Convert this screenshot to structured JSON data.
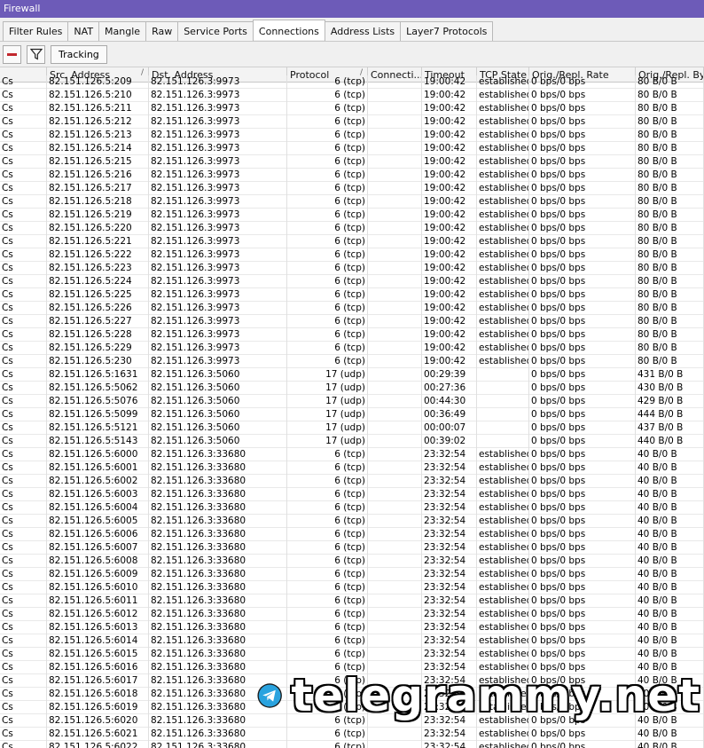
{
  "window": {
    "title": "Firewall"
  },
  "tabs": [
    {
      "label": "Filter Rules",
      "width": 66
    },
    {
      "label": "NAT",
      "width": 36
    },
    {
      "label": "Mangle",
      "width": 50
    },
    {
      "label": "Raw",
      "width": 36
    },
    {
      "label": "Service Ports",
      "width": 76
    },
    {
      "label": "Connections",
      "width": 74,
      "active": true
    },
    {
      "label": "Address Lists",
      "width": 76
    },
    {
      "label": "Layer7 Protocols",
      "width": 92
    }
  ],
  "toolbar": {
    "remove_icon": "minus-icon",
    "filter_icon": "filter-icon",
    "tracking_label": "Tracking"
  },
  "columns": [
    "",
    "Src. Address",
    "Dst. Address",
    "Protocol",
    "Connecti...",
    "Timeout",
    "TCP State",
    "Orig./Repl. Rate",
    "Orig./Repl. Bytes"
  ],
  "rows": [
    [
      "Cs",
      "82.151.126.5:209",
      "82.151.126.3:9973",
      "6 (tcp)",
      "",
      "19:00:42",
      "established",
      "0 bps/0 bps",
      "80 B/0 B"
    ],
    [
      "Cs",
      "82.151.126.5:210",
      "82.151.126.3:9973",
      "6 (tcp)",
      "",
      "19:00:42",
      "established",
      "0 bps/0 bps",
      "80 B/0 B"
    ],
    [
      "Cs",
      "82.151.126.5:211",
      "82.151.126.3:9973",
      "6 (tcp)",
      "",
      "19:00:42",
      "established",
      "0 bps/0 bps",
      "80 B/0 B"
    ],
    [
      "Cs",
      "82.151.126.5:212",
      "82.151.126.3:9973",
      "6 (tcp)",
      "",
      "19:00:42",
      "established",
      "0 bps/0 bps",
      "80 B/0 B"
    ],
    [
      "Cs",
      "82.151.126.5:213",
      "82.151.126.3:9973",
      "6 (tcp)",
      "",
      "19:00:42",
      "established",
      "0 bps/0 bps",
      "80 B/0 B"
    ],
    [
      "Cs",
      "82.151.126.5:214",
      "82.151.126.3:9973",
      "6 (tcp)",
      "",
      "19:00:42",
      "established",
      "0 bps/0 bps",
      "80 B/0 B"
    ],
    [
      "Cs",
      "82.151.126.5:215",
      "82.151.126.3:9973",
      "6 (tcp)",
      "",
      "19:00:42",
      "established",
      "0 bps/0 bps",
      "80 B/0 B"
    ],
    [
      "Cs",
      "82.151.126.5:216",
      "82.151.126.3:9973",
      "6 (tcp)",
      "",
      "19:00:42",
      "established",
      "0 bps/0 bps",
      "80 B/0 B"
    ],
    [
      "Cs",
      "82.151.126.5:217",
      "82.151.126.3:9973",
      "6 (tcp)",
      "",
      "19:00:42",
      "established",
      "0 bps/0 bps",
      "80 B/0 B"
    ],
    [
      "Cs",
      "82.151.126.5:218",
      "82.151.126.3:9973",
      "6 (tcp)",
      "",
      "19:00:42",
      "established",
      "0 bps/0 bps",
      "80 B/0 B"
    ],
    [
      "Cs",
      "82.151.126.5:219",
      "82.151.126.3:9973",
      "6 (tcp)",
      "",
      "19:00:42",
      "established",
      "0 bps/0 bps",
      "80 B/0 B"
    ],
    [
      "Cs",
      "82.151.126.5:220",
      "82.151.126.3:9973",
      "6 (tcp)",
      "",
      "19:00:42",
      "established",
      "0 bps/0 bps",
      "80 B/0 B"
    ],
    [
      "Cs",
      "82.151.126.5:221",
      "82.151.126.3:9973",
      "6 (tcp)",
      "",
      "19:00:42",
      "established",
      "0 bps/0 bps",
      "80 B/0 B"
    ],
    [
      "Cs",
      "82.151.126.5:222",
      "82.151.126.3:9973",
      "6 (tcp)",
      "",
      "19:00:42",
      "established",
      "0 bps/0 bps",
      "80 B/0 B"
    ],
    [
      "Cs",
      "82.151.126.5:223",
      "82.151.126.3:9973",
      "6 (tcp)",
      "",
      "19:00:42",
      "established",
      "0 bps/0 bps",
      "80 B/0 B"
    ],
    [
      "Cs",
      "82.151.126.5:224",
      "82.151.126.3:9973",
      "6 (tcp)",
      "",
      "19:00:42",
      "established",
      "0 bps/0 bps",
      "80 B/0 B"
    ],
    [
      "Cs",
      "82.151.126.5:225",
      "82.151.126.3:9973",
      "6 (tcp)",
      "",
      "19:00:42",
      "established",
      "0 bps/0 bps",
      "80 B/0 B"
    ],
    [
      "Cs",
      "82.151.126.5:226",
      "82.151.126.3:9973",
      "6 (tcp)",
      "",
      "19:00:42",
      "established",
      "0 bps/0 bps",
      "80 B/0 B"
    ],
    [
      "Cs",
      "82.151.126.5:227",
      "82.151.126.3:9973",
      "6 (tcp)",
      "",
      "19:00:42",
      "established",
      "0 bps/0 bps",
      "80 B/0 B"
    ],
    [
      "Cs",
      "82.151.126.5:228",
      "82.151.126.3:9973",
      "6 (tcp)",
      "",
      "19:00:42",
      "established",
      "0 bps/0 bps",
      "80 B/0 B"
    ],
    [
      "Cs",
      "82.151.126.5:229",
      "82.151.126.3:9973",
      "6 (tcp)",
      "",
      "19:00:42",
      "established",
      "0 bps/0 bps",
      "80 B/0 B"
    ],
    [
      "Cs",
      "82.151.126.5:230",
      "82.151.126.3:9973",
      "6 (tcp)",
      "",
      "19:00:42",
      "established",
      "0 bps/0 bps",
      "80 B/0 B"
    ],
    [
      "Cs",
      "82.151.126.5:1631",
      "82.151.126.3:5060",
      "17 (udp)",
      "",
      "00:29:39",
      "",
      "0 bps/0 bps",
      "431 B/0 B"
    ],
    [
      "Cs",
      "82.151.126.5:5062",
      "82.151.126.3:5060",
      "17 (udp)",
      "",
      "00:27:36",
      "",
      "0 bps/0 bps",
      "430 B/0 B"
    ],
    [
      "Cs",
      "82.151.126.5:5076",
      "82.151.126.3:5060",
      "17 (udp)",
      "",
      "00:44:30",
      "",
      "0 bps/0 bps",
      "429 B/0 B"
    ],
    [
      "Cs",
      "82.151.126.5:5099",
      "82.151.126.3:5060",
      "17 (udp)",
      "",
      "00:36:49",
      "",
      "0 bps/0 bps",
      "444 B/0 B"
    ],
    [
      "Cs",
      "82.151.126.5:5121",
      "82.151.126.3:5060",
      "17 (udp)",
      "",
      "00:00:07",
      "",
      "0 bps/0 bps",
      "437 B/0 B"
    ],
    [
      "Cs",
      "82.151.126.5:5143",
      "82.151.126.3:5060",
      "17 (udp)",
      "",
      "00:39:02",
      "",
      "0 bps/0 bps",
      "440 B/0 B"
    ],
    [
      "Cs",
      "82.151.126.5:6000",
      "82.151.126.3:33680",
      "6 (tcp)",
      "",
      "23:32:54",
      "established",
      "0 bps/0 bps",
      "40 B/0 B"
    ],
    [
      "Cs",
      "82.151.126.5:6001",
      "82.151.126.3:33680",
      "6 (tcp)",
      "",
      "23:32:54",
      "established",
      "0 bps/0 bps",
      "40 B/0 B"
    ],
    [
      "Cs",
      "82.151.126.5:6002",
      "82.151.126.3:33680",
      "6 (tcp)",
      "",
      "23:32:54",
      "established",
      "0 bps/0 bps",
      "40 B/0 B"
    ],
    [
      "Cs",
      "82.151.126.5:6003",
      "82.151.126.3:33680",
      "6 (tcp)",
      "",
      "23:32:54",
      "established",
      "0 bps/0 bps",
      "40 B/0 B"
    ],
    [
      "Cs",
      "82.151.126.5:6004",
      "82.151.126.3:33680",
      "6 (tcp)",
      "",
      "23:32:54",
      "established",
      "0 bps/0 bps",
      "40 B/0 B"
    ],
    [
      "Cs",
      "82.151.126.5:6005",
      "82.151.126.3:33680",
      "6 (tcp)",
      "",
      "23:32:54",
      "established",
      "0 bps/0 bps",
      "40 B/0 B"
    ],
    [
      "Cs",
      "82.151.126.5:6006",
      "82.151.126.3:33680",
      "6 (tcp)",
      "",
      "23:32:54",
      "established",
      "0 bps/0 bps",
      "40 B/0 B"
    ],
    [
      "Cs",
      "82.151.126.5:6007",
      "82.151.126.3:33680",
      "6 (tcp)",
      "",
      "23:32:54",
      "established",
      "0 bps/0 bps",
      "40 B/0 B"
    ],
    [
      "Cs",
      "82.151.126.5:6008",
      "82.151.126.3:33680",
      "6 (tcp)",
      "",
      "23:32:54",
      "established",
      "0 bps/0 bps",
      "40 B/0 B"
    ],
    [
      "Cs",
      "82.151.126.5:6009",
      "82.151.126.3:33680",
      "6 (tcp)",
      "",
      "23:32:54",
      "established",
      "0 bps/0 bps",
      "40 B/0 B"
    ],
    [
      "Cs",
      "82.151.126.5:6010",
      "82.151.126.3:33680",
      "6 (tcp)",
      "",
      "23:32:54",
      "established",
      "0 bps/0 bps",
      "40 B/0 B"
    ],
    [
      "Cs",
      "82.151.126.5:6011",
      "82.151.126.3:33680",
      "6 (tcp)",
      "",
      "23:32:54",
      "established",
      "0 bps/0 bps",
      "40 B/0 B"
    ],
    [
      "Cs",
      "82.151.126.5:6012",
      "82.151.126.3:33680",
      "6 (tcp)",
      "",
      "23:32:54",
      "established",
      "0 bps/0 bps",
      "40 B/0 B"
    ],
    [
      "Cs",
      "82.151.126.5:6013",
      "82.151.126.3:33680",
      "6 (tcp)",
      "",
      "23:32:54",
      "established",
      "0 bps/0 bps",
      "40 B/0 B"
    ],
    [
      "Cs",
      "82.151.126.5:6014",
      "82.151.126.3:33680",
      "6 (tcp)",
      "",
      "23:32:54",
      "established",
      "0 bps/0 bps",
      "40 B/0 B"
    ],
    [
      "Cs",
      "82.151.126.5:6015",
      "82.151.126.3:33680",
      "6 (tcp)",
      "",
      "23:32:54",
      "established",
      "0 bps/0 bps",
      "40 B/0 B"
    ],
    [
      "Cs",
      "82.151.126.5:6016",
      "82.151.126.3:33680",
      "6 (tcp)",
      "",
      "23:32:54",
      "established",
      "0 bps/0 bps",
      "40 B/0 B"
    ],
    [
      "Cs",
      "82.151.126.5:6017",
      "82.151.126.3:33680",
      "6 (tcp)",
      "",
      "23:32:54",
      "established",
      "0 bps/0 bps",
      "40 B/0 B"
    ],
    [
      "Cs",
      "82.151.126.5:6018",
      "82.151.126.3:33680",
      "6 (tcp)",
      "",
      "23:32:54",
      "established",
      "0 bps/0 bps",
      "40 B/0 B"
    ],
    [
      "Cs",
      "82.151.126.5:6019",
      "82.151.126.3:33680",
      "6 (tcp)",
      "",
      "23:32:54",
      "established",
      "0 bps/0 bps",
      "40 B/0 B"
    ],
    [
      "Cs",
      "82.151.126.5:6020",
      "82.151.126.3:33680",
      "6 (tcp)",
      "",
      "23:32:54",
      "established",
      "0 bps/0 bps",
      "40 B/0 B"
    ],
    [
      "Cs",
      "82.151.126.5:6021",
      "82.151.126.3:33680",
      "6 (tcp)",
      "",
      "23:32:54",
      "established",
      "0 bps/0 bps",
      "40 B/0 B"
    ],
    [
      "Cs",
      "82.151.126.5:6022",
      "82.151.126.3:33680",
      "6 (tcp)",
      "",
      "23:32:54",
      "established",
      "0 bps/0 bps",
      "40 B/0 B"
    ]
  ],
  "watermark": {
    "text": "telegrammy.net",
    "icon": "telegram-logo-icon"
  },
  "colors": {
    "titlebar": "#6d5bb8",
    "remove_button": "#c1272d",
    "telegram_blue": "#2aa3df"
  }
}
